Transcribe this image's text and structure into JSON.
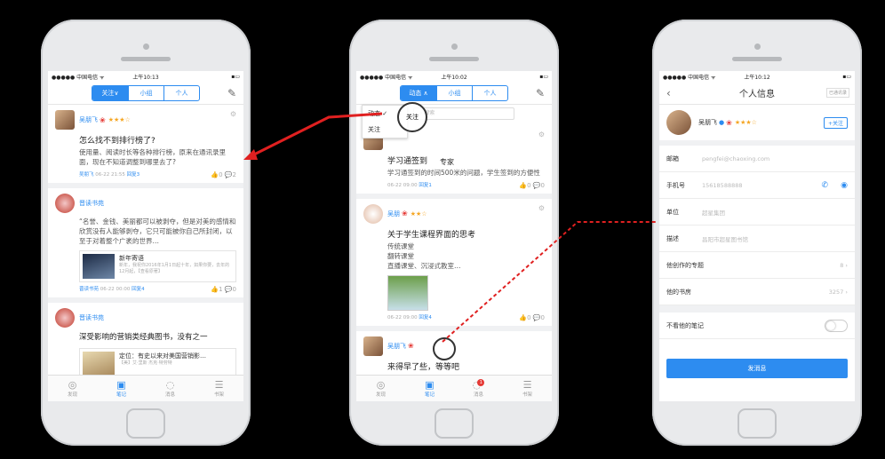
{
  "phone1": {
    "status": {
      "carrier": "●●●●● 中国电信 ᯤ",
      "time": "上午10:13",
      "battery": "▪▭"
    },
    "segments": [
      "关注∨",
      "小组",
      "个人"
    ],
    "cards": [
      {
        "user": "吴朋飞",
        "stars": "★★★☆",
        "title": "怎么找不到排行榜了?",
        "body": "使用量、阅读时长等各种排行榜，原来在通讯录里面，现在不知道调整到哪里去了?",
        "meta_user": "吴朋飞",
        "meta_time": "06-22 21:55",
        "meta_link": "回复3",
        "likes": "0",
        "comments": "2"
      },
      {
        "user": "晋读书苑",
        "body": "“名誉、金钱、美丽都可以被剥夺，但是对美的感情和欣赏没有人能够剥夺，它只可能被你自己所封闭，以至于对着整个广袤的世界…",
        "book_title": "新年寄语",
        "book_desc": "新年，我祝你2016年1月1日起十年，如果你要，去年的12月起，【查看原著】",
        "meta_user": "晋读书苑",
        "meta_time": "06-22 00:00",
        "meta_link": "回复4",
        "likes": "1",
        "comments": "0"
      },
      {
        "user": "晋读书苑",
        "body": "深受影响的营销类经典图书，没有之一",
        "book_title": "定位：有史以来对美国营销影…",
        "book_desc": "【美】艾·里斯 杰克·特劳特"
      }
    ],
    "tabs": [
      "发现",
      "笔记",
      "消息",
      "书架"
    ]
  },
  "phone2": {
    "status": {
      "carrier": "●●●●● 中国电信 ᯤ",
      "time": "上午10:02",
      "battery": "▪▭"
    },
    "segments": [
      "动态 ∧",
      "小组",
      "个人"
    ],
    "dropdown": [
      "动态 ✓",
      "关注"
    ],
    "search_placeholder": "搜索",
    "cards": [
      {
        "user": "",
        "title": "学习通签到",
        "body": "学习通签到的时间500米的问题，学生签到的方便性",
        "meta_time": "06-22 09:00",
        "meta_link": "回复1",
        "likes": "0",
        "comments": "0"
      },
      {
        "user": "吴朋",
        "stars": "★★☆",
        "title": "关于学生课程界面的思考",
        "body": "传统课堂\n翻转课堂\n直播课堂、沉浸式教室…",
        "meta_time": "06-22 09:00",
        "meta_link": "回复4",
        "likes": "0",
        "comments": "0"
      },
      {
        "user": "吴朋飞",
        "title": "来得早了些，等等吧"
      }
    ],
    "magnifier_label": "关注",
    "callout_label": "专家",
    "tabs": [
      "发现",
      "笔记",
      "消息",
      "书架"
    ],
    "badge": "1"
  },
  "phone3": {
    "status": {
      "carrier": "●●●●● 中国电信 ᯤ",
      "time": "上午10:12",
      "battery": "▪▭"
    },
    "title": "个人信息",
    "right_button": "已通讯录",
    "user": "吴朋飞",
    "stars": "★★★☆",
    "follow": "+关注",
    "fields": [
      {
        "label": "邮箱",
        "value": "pengfei@chaoxing.com"
      },
      {
        "label": "手机号",
        "value": "15618588888"
      },
      {
        "label": "单位",
        "value": "超星集团"
      },
      {
        "label": "描述",
        "value": "昌阳市超星图书馆"
      }
    ],
    "links": [
      {
        "label": "他创作的专题",
        "value": "8"
      },
      {
        "label": "他的书房",
        "value": "3257"
      }
    ],
    "toggle_label": "不看他的笔记",
    "message_button": "发消息"
  },
  "colors": {
    "accent": "#2d8cf0",
    "arrow": "#e02020"
  }
}
